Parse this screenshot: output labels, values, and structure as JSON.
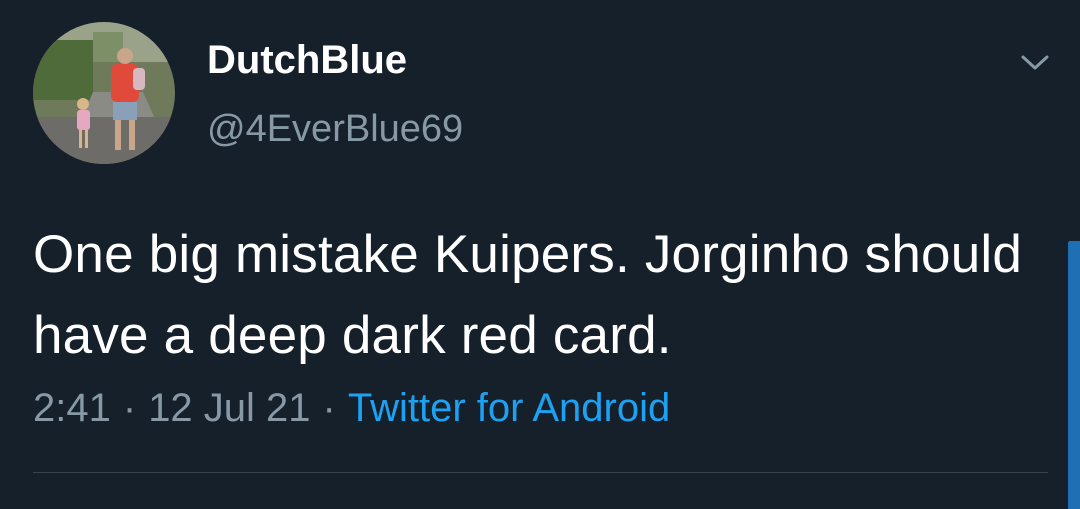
{
  "author": {
    "display_name": "DutchBlue",
    "handle": "@4EverBlue69",
    "avatar_icon": "profile-photo"
  },
  "tweet": {
    "text": "One big mistake Kuipers. Jorginho should have a deep dark red card.",
    "time": "2:41",
    "date": "12 Jul 21",
    "separator": "·",
    "source": "Twitter for Android"
  },
  "menu": {
    "icon": "chevron-down-icon"
  },
  "colors": {
    "background": "#15202b",
    "text_primary": "#ffffff",
    "text_secondary": "#8899a6",
    "link": "#1da1f2",
    "divider": "#38444d"
  }
}
